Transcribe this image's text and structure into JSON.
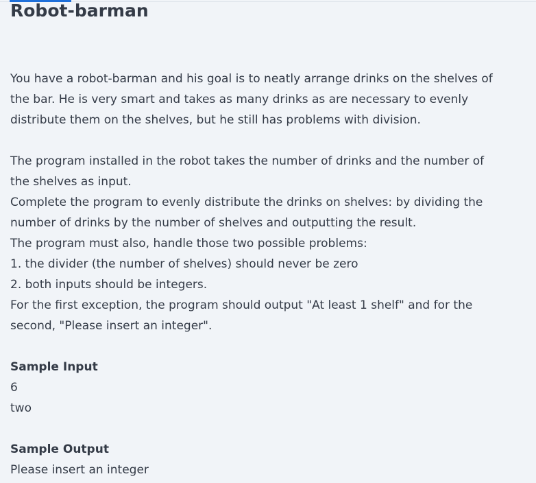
{
  "title": "Robot-barman",
  "intro": [
    "You have a robot-barman and his goal is to neatly arrange drinks on the shelves of",
    "the bar. He is very smart and takes as many drinks as are necessary to evenly",
    "distribute them on the shelves, but he still has problems with division."
  ],
  "body": [
    "The program installed in the robot takes the number of drinks and the number of",
    "the shelves as input.",
    "Complete the program to evenly distribute the drinks on shelves: by dividing the",
    "number of drinks by the number of shelves and outputting the result.",
    "The program must also, handle those two possible problems:",
    "1. the divider (the number of shelves) should never be zero",
    "2. both inputs should be integers.",
    "For the first exception, the program should output \"At least 1 shelf\" and for the",
    "second, \"Please insert an integer\"."
  ],
  "sample_input": {
    "heading": "Sample Input",
    "lines": [
      "6",
      "two"
    ]
  },
  "sample_output": {
    "heading": "Sample Output",
    "lines": [
      "Please insert an integer"
    ]
  }
}
